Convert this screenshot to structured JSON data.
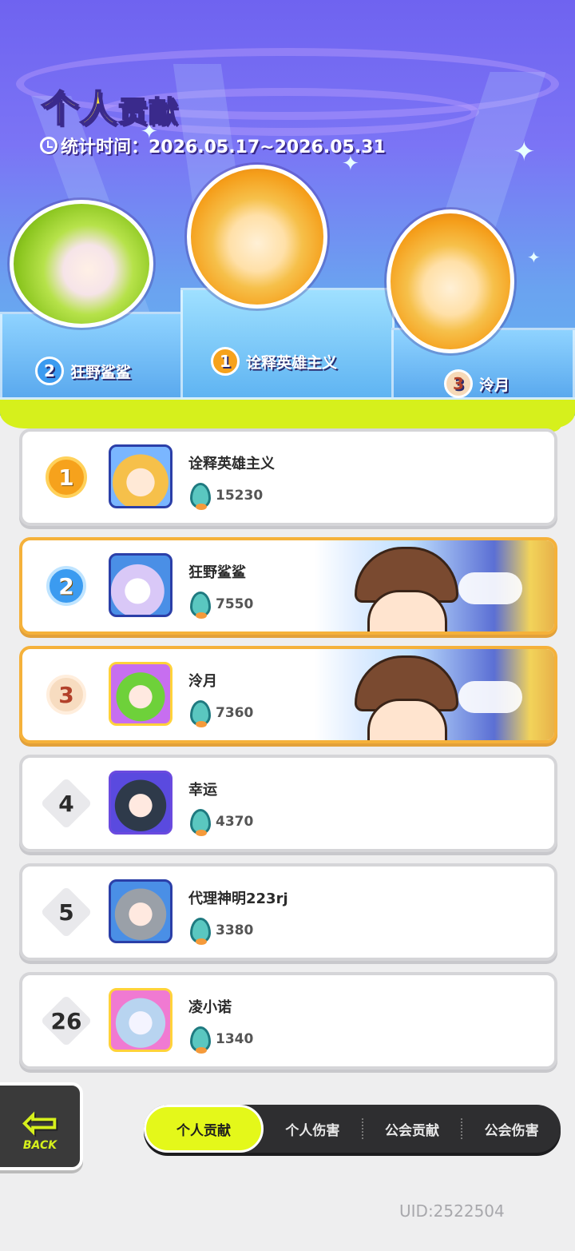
{
  "header": {
    "title_part1": "个人",
    "title_part2": "贡献",
    "stat_time": "统计时间：2026.05.17~2026.05.31"
  },
  "podium": [
    {
      "rank": "2",
      "name": "狂野鲨鲨"
    },
    {
      "rank": "1",
      "name": "诠释英雄主义"
    },
    {
      "rank": "3",
      "name": "泠月"
    }
  ],
  "ranking": [
    {
      "rank": "1",
      "name": "诠释英雄主义",
      "score": "15230"
    },
    {
      "rank": "2",
      "name": "狂野鲨鲨",
      "score": "7550"
    },
    {
      "rank": "3",
      "name": "泠月",
      "score": "7360"
    },
    {
      "rank": "4",
      "name": "幸运",
      "score": "4370"
    },
    {
      "rank": "5",
      "name": "代理神明223rj",
      "score": "3380"
    },
    {
      "rank": "26",
      "name": "凌小诺",
      "score": "1340"
    }
  ],
  "back_button": {
    "label": "BACK",
    "arrow": "⇦"
  },
  "tabs": [
    {
      "label": "个人贡献",
      "active": true
    },
    {
      "label": "个人伤害",
      "active": false
    },
    {
      "label": "公会贡献",
      "active": false
    },
    {
      "label": "公会伤害",
      "active": false
    }
  ],
  "uid": "UID:2522504",
  "colors": {
    "accent_lime": "#d6f01c",
    "highlight_border": "#f5b13a",
    "gold": "#f6a21c",
    "blue": "#3b9bf0"
  }
}
